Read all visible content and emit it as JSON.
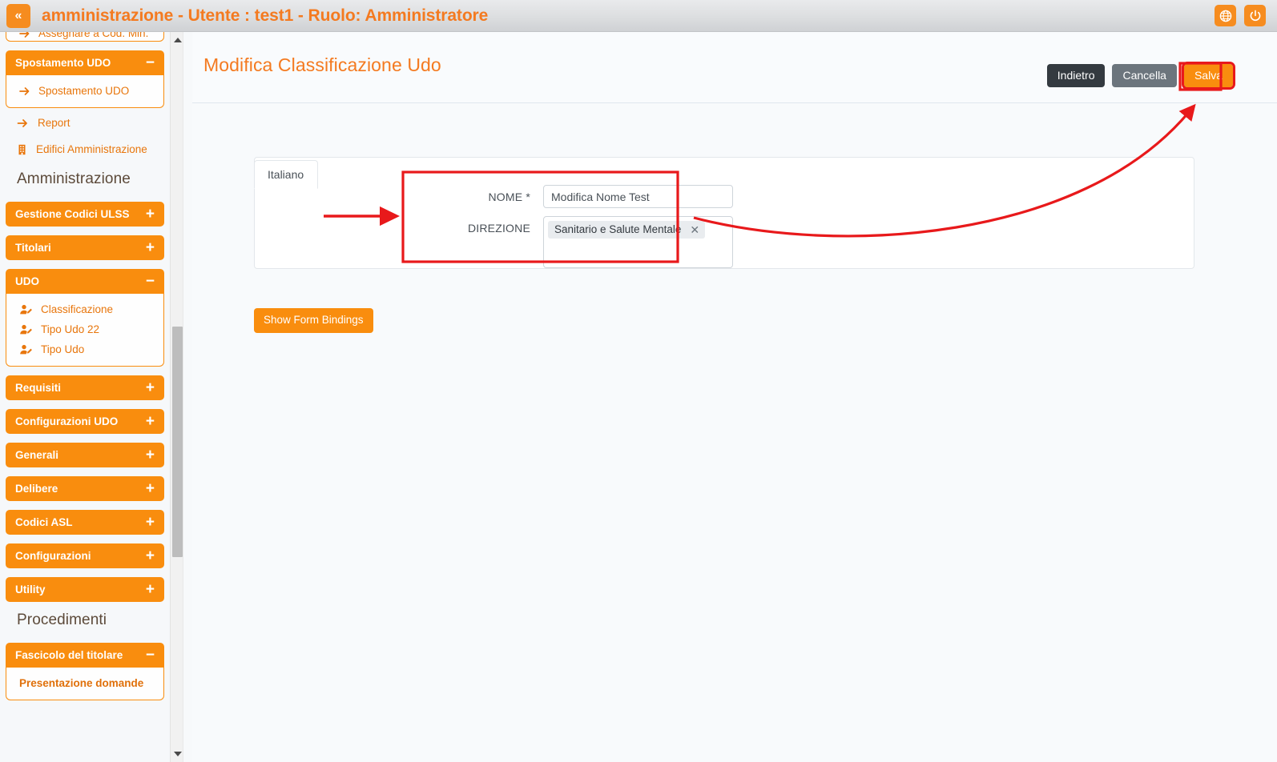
{
  "header": {
    "collapse_icon": "double-chevron-left-icon",
    "title": "amministrazione - Utente : test1 - Ruolo: Amministratore",
    "globe_icon": "globe-icon",
    "power_icon": "power-icon",
    "accent_color": "#f47a20"
  },
  "sidebar": {
    "cut_item": {
      "label": "Assegnare a Cod. Min.",
      "icon": "arrow-right-icon"
    },
    "groups": [
      {
        "label": "Spostamento UDO",
        "sign": "−",
        "expanded": true,
        "items": [
          {
            "label": "Spostamento UDO",
            "icon": "arrow-right-icon"
          }
        ]
      }
    ],
    "flat_items": [
      {
        "label": "Report",
        "icon": "arrow-right-icon"
      },
      {
        "label": "Edifici Amministrazione",
        "icon": "building-icon"
      }
    ],
    "section_amministrazione": "Amministrazione",
    "collapsed_groups_1": [
      {
        "label": "Gestione Codici ULSS",
        "sign": "+"
      },
      {
        "label": "Titolari",
        "sign": "+"
      }
    ],
    "udo_group": {
      "label": "UDO",
      "sign": "−",
      "items": [
        {
          "label": "Classificazione",
          "icon": "user-edit-icon"
        },
        {
          "label": "Tipo Udo 22",
          "icon": "user-edit-icon"
        },
        {
          "label": "Tipo Udo",
          "icon": "user-edit-icon"
        }
      ]
    },
    "collapsed_groups_2": [
      {
        "label": "Requisiti",
        "sign": "+"
      },
      {
        "label": "Configurazioni UDO",
        "sign": "+"
      },
      {
        "label": "Generali",
        "sign": "+"
      },
      {
        "label": "Delibere",
        "sign": "+"
      },
      {
        "label": "Codici ASL",
        "sign": "+"
      },
      {
        "label": "Configurazioni",
        "sign": "+"
      },
      {
        "label": "Utility",
        "sign": "+"
      }
    ],
    "section_procedimenti": "Procedimenti",
    "fascicolo_group": {
      "label": "Fascicolo del titolare",
      "sign": "−",
      "items": [
        {
          "label": "Presentazione domande"
        }
      ]
    },
    "scrollbar": {
      "up_arrow_icon": "scroll-up-arrow-icon",
      "down_arrow_icon": "scroll-down-arrow-icon",
      "thumb_name": "sidebar-scroll-thumb"
    },
    "accent_color": "#f98d0e"
  },
  "main": {
    "page_title": "Modifica Classificazione Udo",
    "buttons": {
      "back": "Indietro",
      "cancel": "Cancella",
      "save": "Salva"
    },
    "tab": {
      "label": "Italiano"
    },
    "form": {
      "nome": {
        "label": "NOME *",
        "value": "Modifica Nome Test"
      },
      "direzione": {
        "label": "DIREZIONE",
        "chips": [
          {
            "label": "Sanitario e Salute Mentale",
            "remove_icon": "close-x-icon"
          }
        ]
      }
    },
    "show_form_bindings": "Show Form Bindings"
  },
  "annotations": {
    "highlight_color": "#e8191b",
    "arrow_to_fields": "arrow-pointing-right-at-form-fields",
    "box_around_fields": "red-rectangle-around-form-fields",
    "curve_to_save": "curved-arrow-from-fields-to-save-button",
    "box_around_save": "red-rectangle-around-save-button"
  }
}
